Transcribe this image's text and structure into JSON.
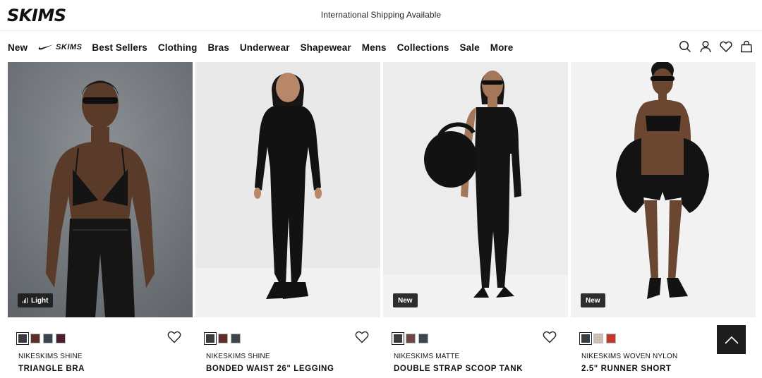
{
  "brand": {
    "logo_text": "SKIMS"
  },
  "announcement": "International Shipping Available",
  "nav": {
    "items_before": [
      "New"
    ],
    "collab_label": "SKIMS",
    "items_after": [
      "Best Sellers",
      "Clothing",
      "Bras",
      "Underwear",
      "Shapewear",
      "Mens",
      "Collections",
      "Sale",
      "More"
    ],
    "icons": [
      "search-icon",
      "account-icon",
      "heart-icon",
      "bag-icon"
    ]
  },
  "products": [
    {
      "collection": "NIKESKIMS SHINE",
      "name": "TRIANGLE BRA",
      "badge": "Light",
      "swatches": [
        "#3a3d40",
        "#5a2e2a",
        "#3c4650",
        "#4a1d33"
      ],
      "selected_swatch": 0
    },
    {
      "collection": "NIKESKIMS SHINE",
      "name": "BONDED WAIST 26\" LEGGING",
      "badge": "",
      "swatches": [
        "#3a3d40",
        "#5a2e2a",
        "#3c4650"
      ],
      "selected_swatch": 0
    },
    {
      "collection": "NIKESKIMS MATTE",
      "name": "DOUBLE STRAP SCOOP TANK",
      "badge": "New",
      "swatches": [
        "#3a3d40",
        "#6b4a44",
        "#3c4650"
      ],
      "selected_swatch": 0
    },
    {
      "collection": "NIKESKIMS WOVEN NYLON",
      "name": "2.5\" RUNNER SHORT",
      "badge": "New",
      "swatches": [
        "#3a3d40",
        "#c9c0b3",
        "#c0392b"
      ],
      "selected_swatch": 0
    }
  ],
  "scroll_top": {
    "icon": "chevron-up-icon"
  }
}
